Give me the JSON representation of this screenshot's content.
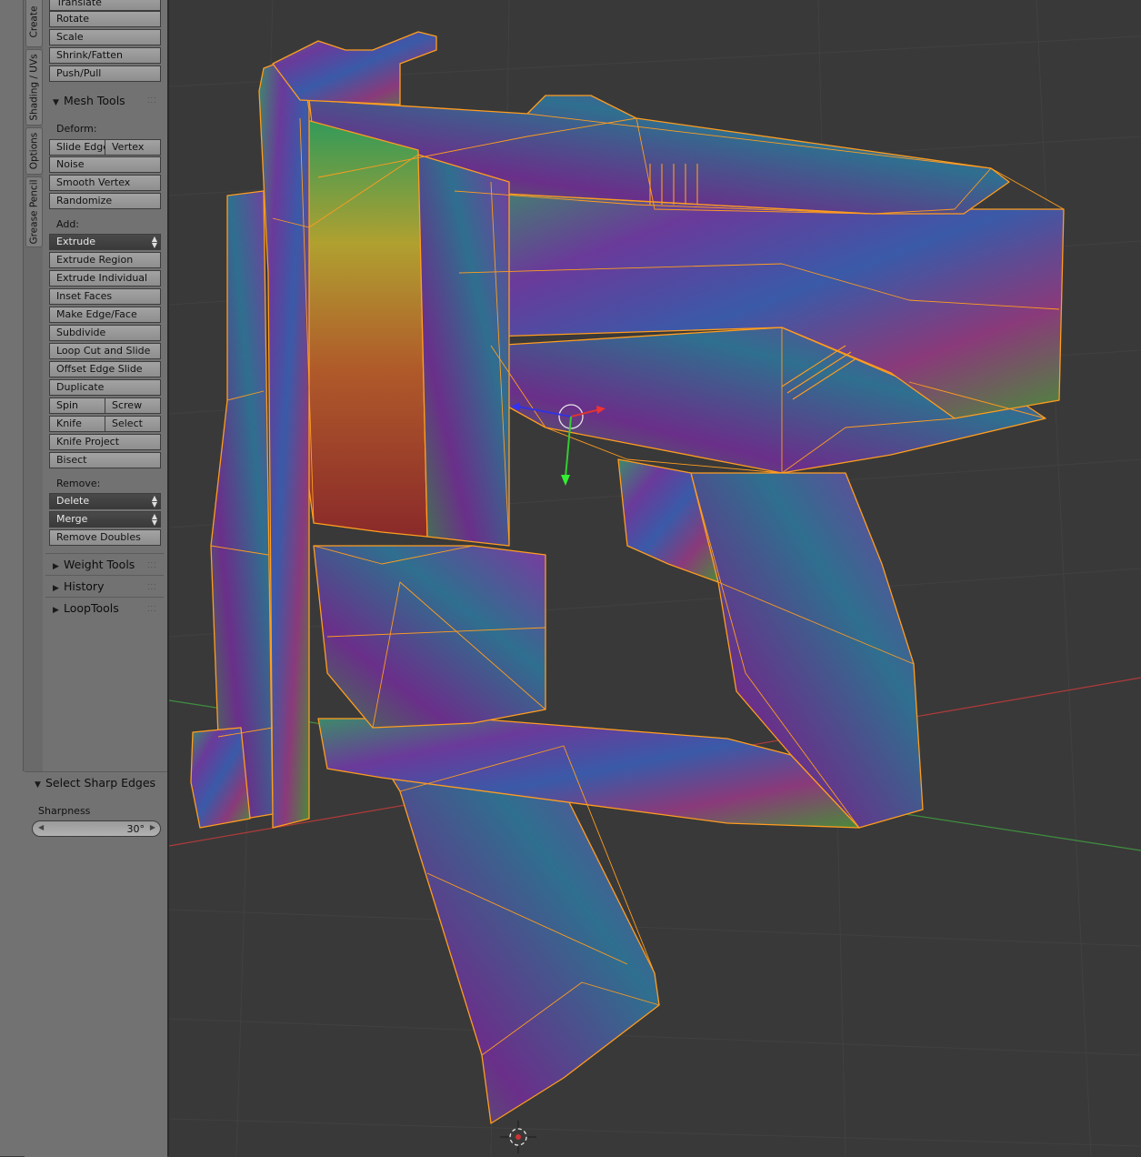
{
  "vtabs": [
    "Create",
    "Shading / UVs",
    "Options",
    "Grease Pencil"
  ],
  "transform_buttons": [
    "Translate",
    "Rotate",
    "Scale",
    "Shrink/Fatten",
    "Push/Pull"
  ],
  "mesh_tools": {
    "header": "Mesh Tools",
    "deform_label": "Deform:",
    "slide_edge": "Slide Edge",
    "vertex": "Vertex",
    "noise": "Noise",
    "smooth_vertex": "Smooth Vertex",
    "randomize": "Randomize",
    "add_label": "Add:",
    "extrude": "Extrude",
    "extrude_region": "Extrude Region",
    "extrude_individual": "Extrude Individual",
    "inset_faces": "Inset Faces",
    "make_edge_face": "Make Edge/Face",
    "subdivide": "Subdivide",
    "loop_cut": "Loop Cut and Slide",
    "offset_edge_slide": "Offset Edge Slide",
    "duplicate": "Duplicate",
    "spin": "Spin",
    "screw": "Screw",
    "knife": "Knife",
    "select": "Select",
    "knife_project": "Knife Project",
    "bisect": "Bisect",
    "remove_label": "Remove:",
    "delete": "Delete",
    "merge": "Merge",
    "remove_doubles": "Remove Doubles"
  },
  "collapsed_panels": [
    "Weight Tools",
    "History",
    "LoopTools"
  ],
  "operator_panel": {
    "header": "Select Sharp Edges",
    "sharpness_label": "Sharpness",
    "sharpness_value": "30°"
  },
  "colors": {
    "viewport_bg": "#393939",
    "wire": "#ff9d1e",
    "axis_x": "#b23a3a",
    "axis_y": "#3f8f3f"
  }
}
